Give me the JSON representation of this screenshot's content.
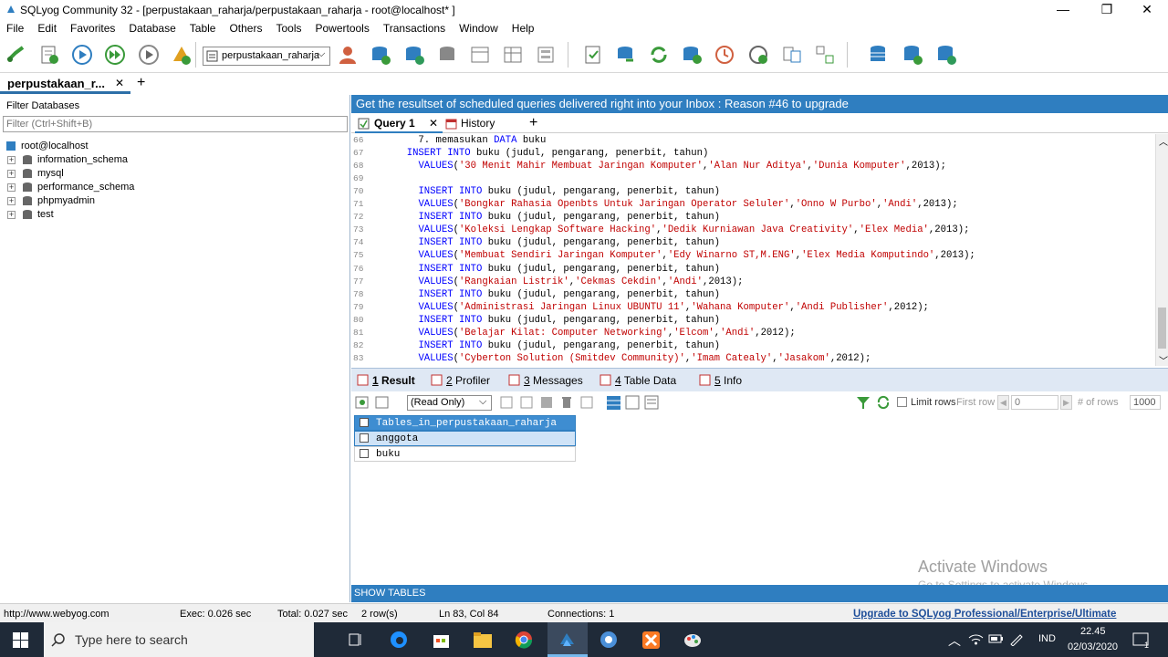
{
  "window": {
    "title": "SQLyog Community 32 - [perpustakaan_raharja/perpustakaan_raharja - root@localhost* ]",
    "minimize_glyph": "—",
    "restore_glyph": "❐",
    "close_glyph": "✕"
  },
  "menu": [
    "File",
    "Edit",
    "Favorites",
    "Database",
    "Table",
    "Others",
    "Tools",
    "Powertools",
    "Transactions",
    "Window",
    "Help"
  ],
  "toolbar": {
    "database_selector": "perpustakaan_raharja",
    "icons": [
      "new-connection-icon",
      "new-query-icon",
      "execute-query-icon",
      "execute-all-icon",
      "execute-edit-icon",
      "schema-designer-icon",
      "database-selector",
      "user-manager-icon",
      "backup-icon",
      "restore-icon",
      "db-sync-icon",
      "table-icon",
      "schema-icon",
      "structure-icon",
      "query-builder-icon",
      "import-icon",
      "refresh-icon",
      "export-icon",
      "scheduled-job-icon",
      "notification-icon",
      "compare-icon",
      "sync-icon",
      "db-copy-icon",
      "db-check-icon",
      "db-add-icon"
    ]
  },
  "connection_tab": {
    "label": "perpustakaan_r...",
    "close_glyph": "✕",
    "add_glyph": "+"
  },
  "left_panel": {
    "filter_label": "Filter Databases",
    "filter_placeholder": "Filter (Ctrl+Shift+B)",
    "root": "root@localhost",
    "databases": [
      "information_schema",
      "mysql",
      "performance_schema",
      "phpmyadmin",
      "test"
    ]
  },
  "banner": "Get the resultset of scheduled queries delivered right into your Inbox : Reason #46 to upgrade",
  "query_tabs": {
    "query_label": "Query 1",
    "history_label": "History",
    "add_glyph": "+"
  },
  "editor": {
    "lines": [
      {
        "n": "66",
        "parts": [
          [
            "plain",
            "    7. memasukan "
          ],
          [
            "kw",
            "DATA"
          ],
          [
            "plain",
            " buku"
          ]
        ]
      },
      {
        "n": "67",
        "parts": [
          [
            "plain",
            "  "
          ],
          [
            "kw",
            "INSERT INTO"
          ],
          [
            "plain",
            " buku (judul, pengarang, penerbit, tahun)"
          ]
        ]
      },
      {
        "n": "68",
        "parts": [
          [
            "plain",
            "    "
          ],
          [
            "kw",
            "VALUES"
          ],
          [
            "plain",
            "("
          ],
          [
            "str",
            "'30 Menit Mahir Membuat Jaringan Komputer'"
          ],
          [
            "plain",
            ","
          ],
          [
            "str",
            "'Alan Nur Aditya'"
          ],
          [
            "plain",
            ","
          ],
          [
            "str",
            "'Dunia Komputer'"
          ],
          [
            "plain",
            ",2013);"
          ]
        ]
      },
      {
        "n": "69",
        "parts": [
          [
            "plain",
            ""
          ]
        ]
      },
      {
        "n": "70",
        "parts": [
          [
            "plain",
            "    "
          ],
          [
            "kw",
            "INSERT INTO"
          ],
          [
            "plain",
            " buku (judul, pengarang, penerbit, tahun)"
          ]
        ]
      },
      {
        "n": "71",
        "parts": [
          [
            "plain",
            "    "
          ],
          [
            "kw",
            "VALUES"
          ],
          [
            "plain",
            "("
          ],
          [
            "str",
            "'Bongkar Rahasia Openbts Untuk Jaringan Operator Seluler'"
          ],
          [
            "plain",
            ","
          ],
          [
            "str",
            "'Onno W Purbo'"
          ],
          [
            "plain",
            ","
          ],
          [
            "str",
            "'Andi'"
          ],
          [
            "plain",
            ",2013);"
          ]
        ]
      },
      {
        "n": "72",
        "parts": [
          [
            "plain",
            "    "
          ],
          [
            "kw",
            "INSERT INTO"
          ],
          [
            "plain",
            " buku (judul, pengarang, penerbit, tahun)"
          ]
        ]
      },
      {
        "n": "73",
        "parts": [
          [
            "plain",
            "    "
          ],
          [
            "kw",
            "VALUES"
          ],
          [
            "plain",
            "("
          ],
          [
            "str",
            "'Koleksi Lengkap Software Hacking'"
          ],
          [
            "plain",
            ","
          ],
          [
            "str",
            "'Dedik Kurniawan Java Creativity'"
          ],
          [
            "plain",
            ","
          ],
          [
            "str",
            "'Elex Media'"
          ],
          [
            "plain",
            ",2013);"
          ]
        ]
      },
      {
        "n": "74",
        "parts": [
          [
            "plain",
            "    "
          ],
          [
            "kw",
            "INSERT INTO"
          ],
          [
            "plain",
            " buku (judul, pengarang, penerbit, tahun)"
          ]
        ]
      },
      {
        "n": "75",
        "parts": [
          [
            "plain",
            "    "
          ],
          [
            "kw",
            "VALUES"
          ],
          [
            "plain",
            "("
          ],
          [
            "str",
            "'Membuat Sendiri Jaringan Komputer'"
          ],
          [
            "plain",
            ","
          ],
          [
            "str",
            "'Edy Winarno ST,M.ENG'"
          ],
          [
            "plain",
            ","
          ],
          [
            "str",
            "'Elex Media Komputindo'"
          ],
          [
            "plain",
            ",2013);"
          ]
        ]
      },
      {
        "n": "76",
        "parts": [
          [
            "plain",
            "    "
          ],
          [
            "kw",
            "INSERT INTO"
          ],
          [
            "plain",
            " buku (judul, pengarang, penerbit, tahun)"
          ]
        ]
      },
      {
        "n": "77",
        "parts": [
          [
            "plain",
            "    "
          ],
          [
            "kw",
            "VALUES"
          ],
          [
            "plain",
            "("
          ],
          [
            "str",
            "'Rangkaian Listrik'"
          ],
          [
            "plain",
            ","
          ],
          [
            "str",
            "'Cekmas Cekdin'"
          ],
          [
            "plain",
            ","
          ],
          [
            "str",
            "'Andi'"
          ],
          [
            "plain",
            ",2013);"
          ]
        ]
      },
      {
        "n": "78",
        "parts": [
          [
            "plain",
            "    "
          ],
          [
            "kw",
            "INSERT INTO"
          ],
          [
            "plain",
            " buku (judul, pengarang, penerbit, tahun)"
          ]
        ]
      },
      {
        "n": "79",
        "parts": [
          [
            "plain",
            "    "
          ],
          [
            "kw",
            "VALUES"
          ],
          [
            "plain",
            "("
          ],
          [
            "str",
            "'Administrasi Jaringan Linux UBUNTU 11'"
          ],
          [
            "plain",
            ","
          ],
          [
            "str",
            "'Wahana Komputer'"
          ],
          [
            "plain",
            ","
          ],
          [
            "str",
            "'Andi Publisher'"
          ],
          [
            "plain",
            ",2012);"
          ]
        ]
      },
      {
        "n": "80",
        "parts": [
          [
            "plain",
            "    "
          ],
          [
            "kw",
            "INSERT INTO"
          ],
          [
            "plain",
            " buku (judul, pengarang, penerbit, tahun)"
          ]
        ]
      },
      {
        "n": "81",
        "parts": [
          [
            "plain",
            "    "
          ],
          [
            "kw",
            "VALUES"
          ],
          [
            "plain",
            "("
          ],
          [
            "str",
            "'Belajar Kilat: Computer Networking'"
          ],
          [
            "plain",
            ","
          ],
          [
            "str",
            "'Elcom'"
          ],
          [
            "plain",
            ","
          ],
          [
            "str",
            "'Andi'"
          ],
          [
            "plain",
            ",2012);"
          ]
        ]
      },
      {
        "n": "82",
        "parts": [
          [
            "plain",
            "    "
          ],
          [
            "kw",
            "INSERT INTO"
          ],
          [
            "plain",
            " buku (judul, pengarang, penerbit, tahun)"
          ]
        ]
      },
      {
        "n": "83",
        "parts": [
          [
            "plain",
            "    "
          ],
          [
            "kw",
            "VALUES"
          ],
          [
            "plain",
            "("
          ],
          [
            "str",
            "'Cyberton Solution (Smitdev Community)'"
          ],
          [
            "plain",
            ","
          ],
          [
            "str",
            "'Imam Catealy'"
          ],
          [
            "plain",
            ","
          ],
          [
            "str",
            "'Jasakom'"
          ],
          [
            "plain",
            ",2012);"
          ]
        ]
      }
    ]
  },
  "result_tabs": [
    {
      "num": "1",
      "label": " Result",
      "active": true
    },
    {
      "num": "2",
      "label": " Profiler",
      "active": false
    },
    {
      "num": "3",
      "label": " Messages",
      "active": false
    },
    {
      "num": "4",
      "label": " Table Data",
      "active": false
    },
    {
      "num": "5",
      "label": " Info",
      "active": false
    }
  ],
  "result_toolbar": {
    "mode": "(Read Only)",
    "limit_rows": "Limit rows",
    "first_row_label": "First row",
    "first_row_value": "0",
    "num_rows_label": "# of rows",
    "num_rows_value": "1000"
  },
  "grid": {
    "header": "Tables_in_perpustakaan_raharja",
    "rows": [
      "anggota",
      "buku"
    ]
  },
  "watermark": {
    "line1": "Activate Windows",
    "line2": "Go to Settings to activate Windows."
  },
  "show_tables": "SHOW TABLES",
  "statusbar": {
    "url": "http://www.webyog.com",
    "exec": "Exec: 0.026 sec",
    "total": "Total: 0.027 sec",
    "rows": "2 row(s)",
    "position": "Ln 83, Col 84",
    "connections": "Connections: 1",
    "upgrade": "Upgrade to SQLyog Professional/Enterprise/Ultimate"
  },
  "taskbar": {
    "search_placeholder": "Type here to search",
    "lang": "IND",
    "time": "22.45",
    "date": "02/03/2020",
    "notif_count": "1"
  },
  "colors": {
    "accent": "#2f7ec0",
    "keyword": "#0000ff",
    "string": "#c00000",
    "taskbar": "#1f2a38"
  }
}
